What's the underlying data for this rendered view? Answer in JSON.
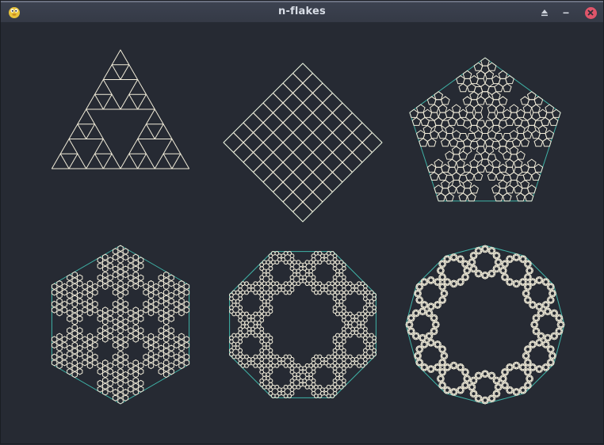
{
  "window": {
    "title": "n-flakes"
  },
  "controls": {
    "shade_icon": "eject-icon",
    "minimize_icon": "minimize-icon",
    "close_icon": "close-icon"
  },
  "colors": {
    "background": "#262a33",
    "stroke": "#f1ecd9",
    "hull": "#3fb4a8"
  },
  "flakes": [
    {
      "sides": 3,
      "depth": 3
    },
    {
      "sides": 4,
      "depth": 3
    },
    {
      "sides": 5,
      "depth": 3
    },
    {
      "sides": 6,
      "depth": 3
    },
    {
      "sides": 8,
      "depth": 3
    },
    {
      "sides": 12,
      "depth": 3
    }
  ]
}
